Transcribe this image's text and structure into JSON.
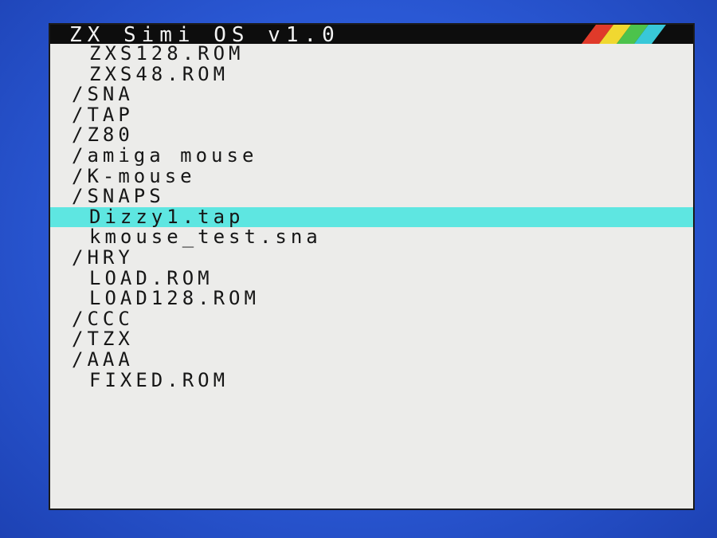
{
  "titlebar": {
    "title": "ZX Simi OS v1.0",
    "stripe_colors": [
      "#e03a2a",
      "#f0d830",
      "#4cc34c",
      "#38c8d8"
    ],
    "background": "#0d0d0d"
  },
  "file_list": {
    "selected_color": "#5ee6e1",
    "items": [
      {
        "label": "ZXS128.ROM",
        "kind": "file",
        "selected": false
      },
      {
        "label": "ZXS48.ROM",
        "kind": "file",
        "selected": false
      },
      {
        "label": "/SNA",
        "kind": "dir",
        "selected": false
      },
      {
        "label": "/TAP",
        "kind": "dir",
        "selected": false
      },
      {
        "label": "/Z80",
        "kind": "dir",
        "selected": false
      },
      {
        "label": "/amiga mouse",
        "kind": "dir",
        "selected": false
      },
      {
        "label": "/K-mouse",
        "kind": "dir",
        "selected": false
      },
      {
        "label": "/SNAPS",
        "kind": "dir",
        "selected": false
      },
      {
        "label": "Dizzy1.tap",
        "kind": "file",
        "selected": true
      },
      {
        "label": "kmouse_test.sna",
        "kind": "file",
        "selected": false
      },
      {
        "label": "/HRY",
        "kind": "dir",
        "selected": false
      },
      {
        "label": "LOAD.ROM",
        "kind": "file",
        "selected": false
      },
      {
        "label": "LOAD128.ROM",
        "kind": "file",
        "selected": false
      },
      {
        "label": "/CCC",
        "kind": "dir",
        "selected": false
      },
      {
        "label": "/TZX",
        "kind": "dir",
        "selected": false
      },
      {
        "label": "/AAA",
        "kind": "dir",
        "selected": false
      },
      {
        "label": "FIXED.ROM",
        "kind": "file",
        "selected": false
      }
    ]
  }
}
